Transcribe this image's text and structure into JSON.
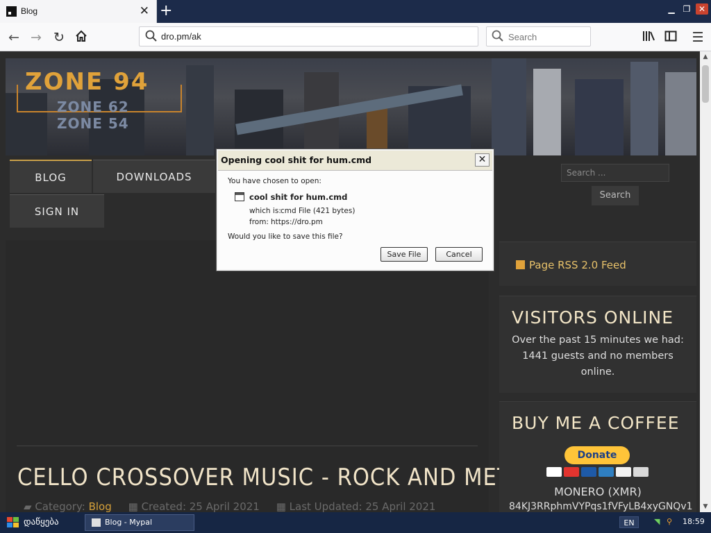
{
  "browser": {
    "tab_title": "Blog",
    "new_tab": "+",
    "url": "dro.pm/ak",
    "search_placeholder": "Search"
  },
  "site": {
    "logo_main": "ZONE 94",
    "logo_sub1": "ZONE 62",
    "logo_sub2": "ZONE 54",
    "menu": [
      "BLOG",
      "DOWNLOADS",
      "SIGN IN"
    ],
    "sidebar_search_placeholder": "Search ...",
    "sidebar_search_button": "Search",
    "rss_label": "Page RSS 2.0 Feed",
    "visitors_heading": "VISITORS ONLINE",
    "visitors_text": "Over the past 15 minutes we had: 1441 guests and no members online.",
    "coffee_heading": "BUY ME A COFFEE",
    "donate_label": "Donate",
    "monero_label": "MONERO (XMR)",
    "monero_address": "84KJ3RRphmVYPqs1fVFyLB4xyGNQv1",
    "post_title": "CELLO CROSSOVER MUSIC - ROCK AND METAL",
    "category_label": "Category:",
    "category_value": "Blog",
    "created": "Created: 25 April 2021",
    "updated": "Last Updated: 25 April 2021"
  },
  "dialog": {
    "title": "Opening cool shit for hum.cmd",
    "intro": "You have chosen to open:",
    "file_name": "cool shit for hum.cmd",
    "which_is_label": "which is:",
    "which_is_value": "cmd File (421 bytes)",
    "from_label": "from:",
    "from_value": "https://dro.pm",
    "question": "Would you like to save this file?",
    "save_button": "Save File",
    "cancel_button": "Cancel"
  },
  "taskbar": {
    "start_label": "დაწყება",
    "window_label": "Blog - Mypal",
    "language": "EN",
    "clock": "18:59"
  },
  "colors": {
    "accent": "#e0a23a",
    "taskbar": "#162644",
    "dialog_bg": "#ece9d8"
  }
}
